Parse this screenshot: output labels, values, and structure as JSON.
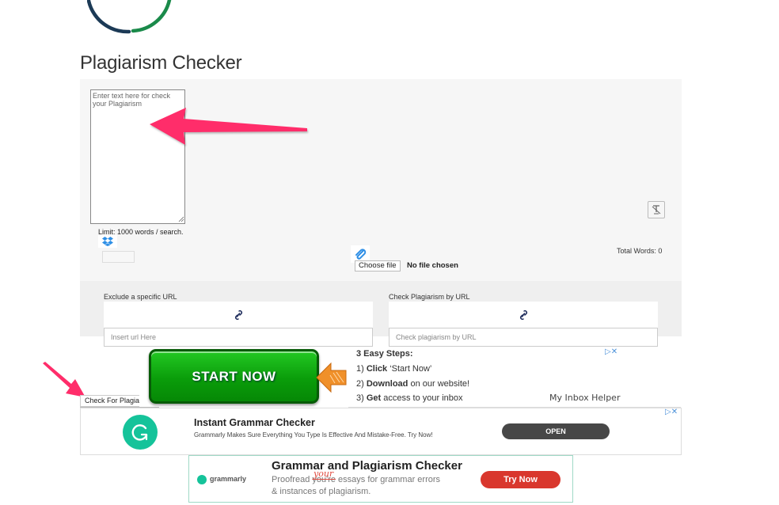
{
  "header": {
    "title": "Plagiarism Checker",
    "logo_colors": {
      "dark": "#1c3a56",
      "green": "#1a8a4a"
    }
  },
  "checker": {
    "text_placeholder": "Enter text here for check your Plagiarism",
    "limit_text": "Limit: 1000 words / search.",
    "file_button_label": "Choose file",
    "file_status": "No file chosen",
    "total_words_label": "Total Words: 0",
    "icons": [
      "dropbox-icon",
      "paperclip-icon",
      "clear-format-icon",
      "link-icon"
    ]
  },
  "url_section": {
    "exclude": {
      "label": "Exclude a specific URL",
      "placeholder": "Insert url Here"
    },
    "check": {
      "label": "Check Plagiarism by URL",
      "placeholder": "Check plagiarism by URL"
    }
  },
  "submit": {
    "label": "Check For Plagiarism",
    "visible_label": "Check For Plagia"
  },
  "annotations": {
    "arrow_color": "#ff2d6a"
  },
  "ads": {
    "ad1": {
      "button_label": "START NOW",
      "steps_title": "3 Easy Steps:",
      "steps": [
        {
          "num": "1)",
          "bold": "Click",
          "rest": " ‘Start Now’"
        },
        {
          "num": "2)",
          "bold": "Download",
          "rest": " on our website!"
        },
        {
          "num": "3)",
          "bold": "Get",
          "rest": " access to your inbox"
        }
      ],
      "brand": "My Inbox Helper",
      "adchoices": "▷✕"
    },
    "ad2": {
      "title": "Instant Grammar Checker",
      "description": "Grammarly Makes Sure Everything You Type Is Effective And Mistake-Free. Try Now!",
      "button_label": "OPEN",
      "adchoices": "▷✕",
      "brand_color": "#15c39a"
    },
    "ad3": {
      "brand": "grammarly",
      "title": "Grammar and Plagiarism Checker",
      "line1_start": "Proofread ",
      "line1_struck": "you're",
      "line1_correction": "your",
      "line1_end": " essays for grammar errors",
      "line2": "& instances of plagiarism.",
      "button_label": "Try Now",
      "button_color": "#d9372d"
    }
  }
}
